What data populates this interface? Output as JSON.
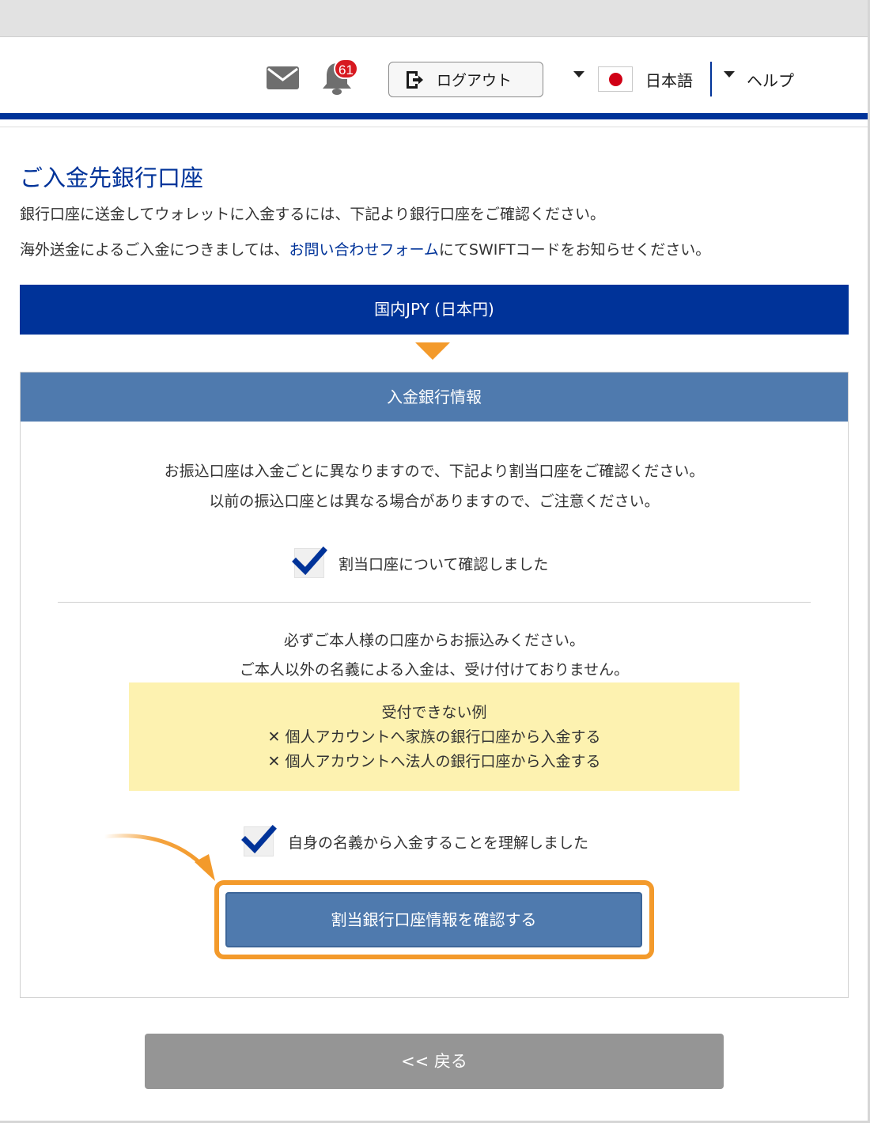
{
  "header": {
    "notification_count": "61",
    "logout_label": "ログアウト",
    "language_label": "日本語",
    "help_label": "ヘルプ"
  },
  "main": {
    "title": "ご入金先銀行口座",
    "intro_line1": "銀行口座に送金してウォレットに入金するには、下記より銀行口座をご確認ください。",
    "intro_line2_prefix": "海外送金によるご入金につきましては、",
    "intro_line2_link": "お問い合わせフォーム",
    "intro_line2_suffix": "にてSWIFTコードをお知らせください。",
    "currency_tab": "国内JPY (日本円)"
  },
  "card": {
    "header": "入金銀行情報",
    "notice1_line1": "お振込口座は入金ごとに異なりますので、下記より割当口座をご確認ください。",
    "notice1_line2": "以前の振込口座とは異なる場合がありますので、ご注意ください。",
    "checkbox1_label": "割当口座について確認しました",
    "notice2_line1": "必ずご本人様の口座からお振込みください。",
    "notice2_line2": "ご本人以外の名義による入金は、受け付けておりません。",
    "warning_title": "受付できない例",
    "warning_items": [
      "✕ 個人アカウントへ家族の銀行口座から入金する",
      "✕ 個人アカウントへ法人の銀行口座から入金する"
    ],
    "checkbox2_label": "自身の名義から入金することを理解しました",
    "confirm_button": "割当銀行口座情報を確認する"
  },
  "back_button": "<< 戻る",
  "colors": {
    "brand_blue": "#003399",
    "card_header": "#4f7aae",
    "highlight_orange": "#f39a2b",
    "warning_yellow": "#fdf2b0"
  },
  "icons": [
    "mail-icon",
    "bell-icon",
    "logout-icon",
    "dropdown-caret-icon",
    "japan-flag-icon",
    "checkmark-icon",
    "pointer-arrow-icon"
  ]
}
